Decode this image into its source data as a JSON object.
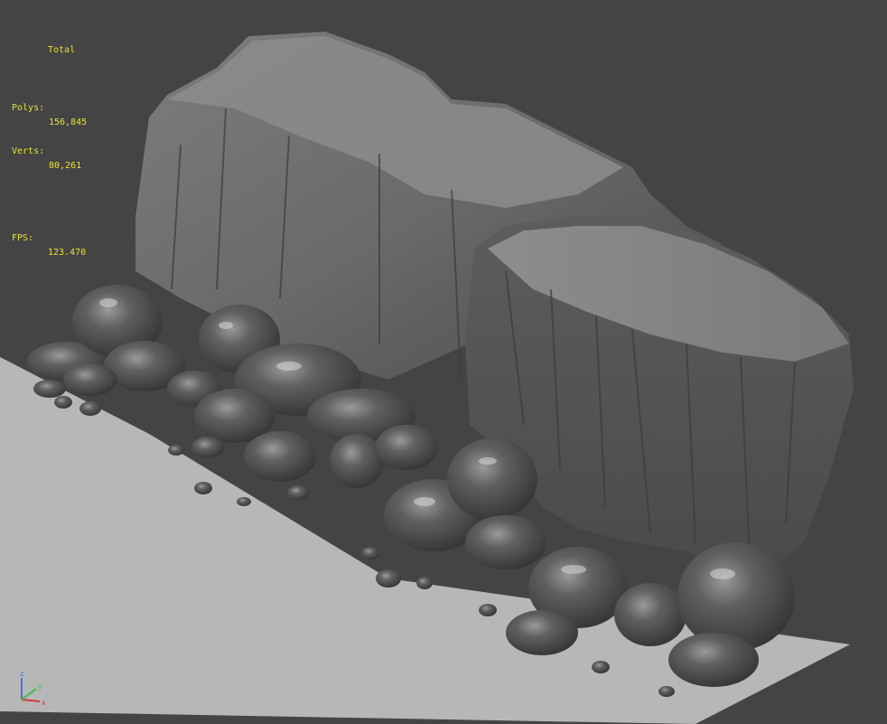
{
  "stats": {
    "header": "Total",
    "polys_label": "Polys:",
    "polys_value": "156,845",
    "verts_label": "Verts:",
    "verts_value": "80,261",
    "fps_label": "FPS:",
    "fps_value": "123.470"
  },
  "axes": {
    "x": "x",
    "y": "y",
    "z": "z"
  },
  "colors": {
    "viewport_background": "#444444",
    "stats_text": "#e8e23a",
    "ground_plane": "#b7b7b7",
    "rock_light": "#8a8a8a",
    "rock_dark": "#3e3e3e",
    "axis_x": "#d23c3c",
    "axis_y": "#3fbf3f",
    "axis_z": "#4a6fe0"
  }
}
